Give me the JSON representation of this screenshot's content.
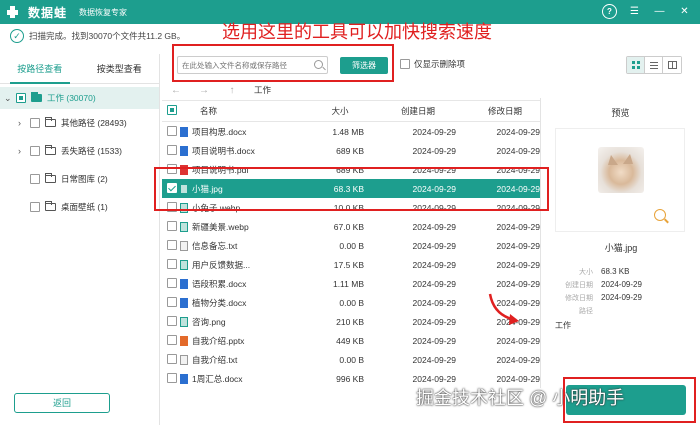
{
  "titlebar": {
    "app_name": "数据蛙",
    "subtitle": "数据恢复专家",
    "help_icon": "?"
  },
  "status": {
    "text": "扫描完成。找到30070个文件共11.2 GB。"
  },
  "annotation": {
    "top_text": "选用这里的工具可以加快搜索速度"
  },
  "left_panel": {
    "tabs": [
      "按路径查看",
      "按类型查看"
    ],
    "root": {
      "label": "工作 (30070)"
    },
    "folders": [
      {
        "label": "其他路径 (28493)",
        "has_arrow": true
      },
      {
        "label": "丢失路径 (1533)",
        "has_arrow": true
      },
      {
        "label": "日常图库 (2)",
        "has_arrow": false
      },
      {
        "label": "桌面壁纸 (1)",
        "has_arrow": false
      }
    ],
    "back_label": "返回"
  },
  "toolbar": {
    "search_placeholder": "在此处输入文件名称或保存路径",
    "filter_label": "筛选器",
    "only_deleted_label": "仅显示删除项"
  },
  "nav": {
    "breadcrumb": "工作"
  },
  "table": {
    "headers": {
      "name": "名称",
      "size": "大小",
      "created": "创建日期",
      "modified": "修改日期"
    },
    "rows": [
      {
        "name": "项目构思.docx",
        "size": "1.48 MB",
        "created": "2024-09-29",
        "modified": "2024-09-29",
        "type": "word",
        "selected": false
      },
      {
        "name": "项目说明书.docx",
        "size": "689 KB",
        "created": "2024-09-29",
        "modified": "2024-09-29",
        "type": "word",
        "selected": false
      },
      {
        "name": "项目说明书.pdf",
        "size": "689 KB",
        "created": "2024-09-29",
        "modified": "2024-09-29",
        "type": "pdf",
        "selected": false
      },
      {
        "name": "小猫.jpg",
        "size": "68.3 KB",
        "created": "2024-09-29",
        "modified": "2024-09-29",
        "type": "img",
        "selected": true
      },
      {
        "name": "小兔子.webp",
        "size": "10.0 KB",
        "created": "2024-09-29",
        "modified": "2024-09-29",
        "type": "img",
        "selected": false
      },
      {
        "name": "新疆美景.webp",
        "size": "67.0 KB",
        "created": "2024-09-29",
        "modified": "2024-09-29",
        "type": "img",
        "selected": false
      },
      {
        "name": "信息备忘.txt",
        "size": "0.00 B",
        "created": "2024-09-29",
        "modified": "2024-09-29",
        "type": "txt",
        "selected": false
      },
      {
        "name": "用户反馈数据...",
        "size": "17.5 KB",
        "created": "2024-09-29",
        "modified": "2024-09-29",
        "type": "img",
        "selected": false
      },
      {
        "name": "语段积累.docx",
        "size": "1.11 MB",
        "created": "2024-09-29",
        "modified": "2024-09-29",
        "type": "word",
        "selected": false
      },
      {
        "name": "植物分类.docx",
        "size": "0.00 B",
        "created": "2024-09-29",
        "modified": "2024-09-29",
        "type": "word",
        "selected": false
      },
      {
        "name": "咨询.png",
        "size": "210 KB",
        "created": "2024-09-29",
        "modified": "2024-09-29",
        "type": "img",
        "selected": false
      },
      {
        "name": "自我介绍.pptx",
        "size": "449 KB",
        "created": "2024-09-29",
        "modified": "2024-09-29",
        "type": "ppt",
        "selected": false
      },
      {
        "name": "自我介绍.txt",
        "size": "0.00 B",
        "created": "2024-09-29",
        "modified": "2024-09-29",
        "type": "txt",
        "selected": false
      },
      {
        "name": "1周汇总.docx",
        "size": "996 KB",
        "created": "2024-09-29",
        "modified": "2024-09-29",
        "type": "word",
        "selected": false
      }
    ]
  },
  "preview": {
    "title": "预览",
    "file_name": "小猫.jpg",
    "meta": [
      {
        "key": "大小",
        "value": "68.3 KB"
      },
      {
        "key": "创建日期",
        "value": "2024-09-29"
      },
      {
        "key": "修改日期",
        "value": "2024-09-29"
      },
      {
        "key": "路径",
        "value": ""
      }
    ],
    "path": "工作"
  },
  "watermark": "掘金技术社区 @ 小明助手",
  "colors": {
    "accent": "#1d9e8e",
    "annotation": "#e02020"
  }
}
